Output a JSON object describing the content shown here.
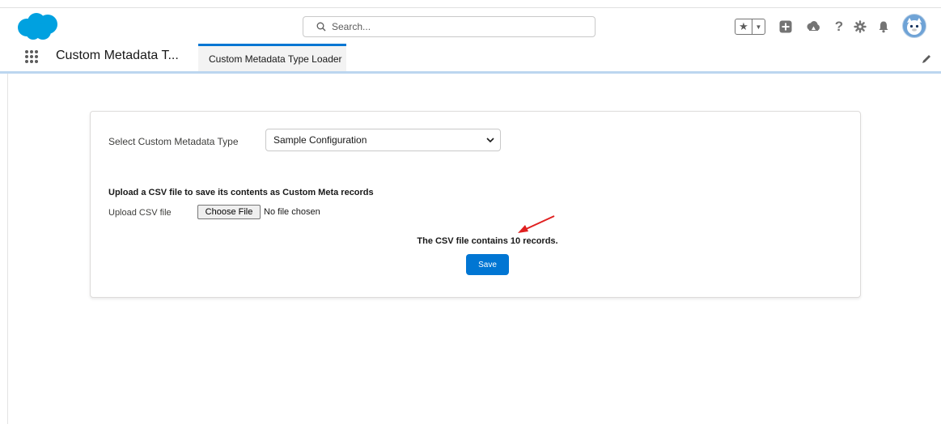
{
  "header": {
    "search_placeholder": "Search...",
    "help_icon_glyph": "?"
  },
  "nav": {
    "app_name": "Custom Metadata T...",
    "tab_label": "Custom Metadata Type Loader"
  },
  "form": {
    "select_label": "Select Custom Metadata Type",
    "select_value": "Sample Configuration",
    "upload_heading": "Upload a CSV file to save its contents as Custom Meta records",
    "upload_label": "Upload CSV file",
    "choose_file_label": "Choose File",
    "no_file_text": "No file chosen",
    "record_count_message": "The CSV file contains 10 records.",
    "save_label": "Save"
  },
  "colors": {
    "brand": "#0176d3",
    "logo": "#00a1e0",
    "annotation_arrow": "#e02020"
  },
  "icons": [
    "salesforce-cloud-logo",
    "search-icon",
    "favorites-star-icon",
    "chevron-down-icon",
    "add-icon",
    "trailhead-icon",
    "help-icon",
    "setup-gear-icon",
    "notifications-bell-icon",
    "user-avatar",
    "app-launcher-icon",
    "edit-pencil-icon",
    "annotation-arrow"
  ]
}
